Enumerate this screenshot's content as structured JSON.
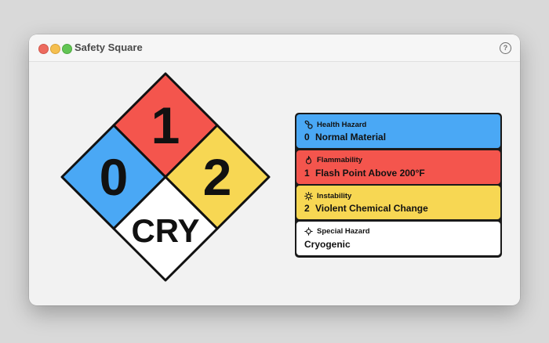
{
  "window": {
    "title": "Safety Square",
    "help_label": "?"
  },
  "diamond": {
    "health": "0",
    "flammability": "1",
    "instability": "2",
    "special": "CRY",
    "colors": {
      "health": "#4aa8f5",
      "flammability": "#f4554d",
      "instability": "#f7d753",
      "special": "#ffffff"
    }
  },
  "hazards": [
    {
      "label": "Health Hazard",
      "rating": "0",
      "description": "Normal Material",
      "icon": "pills-icon",
      "color": "#4aa8f5"
    },
    {
      "label": "Flammability",
      "rating": "1",
      "description": "Flash Point Above 200°F",
      "icon": "flame-icon",
      "color": "#f4554d"
    },
    {
      "label": "Instability",
      "rating": "2",
      "description": "Violent Chemical Change",
      "icon": "burst-icon",
      "color": "#f7d753"
    },
    {
      "label": "Special Hazard",
      "rating": "",
      "description": "Cryogenic",
      "icon": "snowflake-icon",
      "color": "#ffffff"
    }
  ]
}
